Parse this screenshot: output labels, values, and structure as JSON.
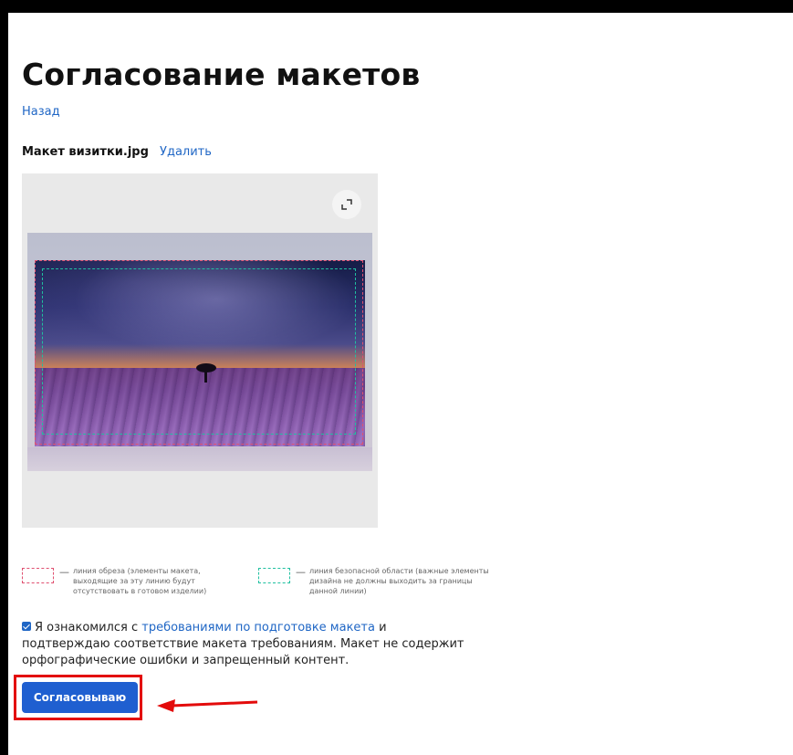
{
  "page": {
    "title": "Согласование макетов",
    "back_link": "Назад"
  },
  "file": {
    "name": "Макет визитки.jpg",
    "delete_label": "Удалить"
  },
  "preview": {
    "expand_icon": "expand-icon"
  },
  "legend": [
    {
      "dash": "—",
      "text": "линия обреза (элементы макета, выходящие за эту линию будут отсутствовать в готовом изделии)"
    },
    {
      "dash": "—",
      "text": "линия безопасной области (важные элементы дизайна не должны выходить за границы данной линии)"
    }
  ],
  "consent": {
    "checked": true,
    "text_before": "Я ознакомился с ",
    "link_text": "требованиями по подготовке макета",
    "text_after": " и подтверждаю соответствие макета требованиям. Макет не содержит орфографические ошибки и запрещенный контент."
  },
  "actions": {
    "approve_label": "Согласовываю"
  },
  "colors": {
    "link": "#1f66c5",
    "button": "#1f5fd0",
    "highlight": "#e30b0b",
    "cut_line": "#e05070",
    "safe_line": "#20c0a0"
  }
}
